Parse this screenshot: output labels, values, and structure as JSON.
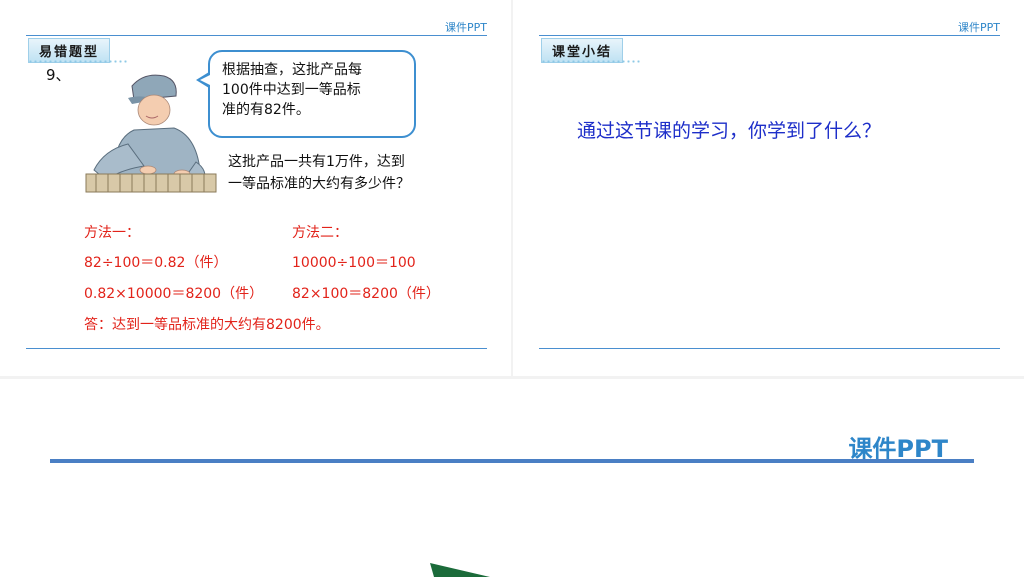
{
  "left_slide": {
    "brand": "课件PPT",
    "tag": "易错题型",
    "question_number": "9、",
    "bubble_lines": [
      "根据抽查，这批产品每",
      "100件中达到一等品标",
      "准的有82件。"
    ],
    "question_lines": [
      "这批产品一共有1万件，达到",
      "一等品标准的大约有多少件？"
    ],
    "method1": {
      "title": "方法一：",
      "line1": "82÷100＝0.82（件）",
      "line2": "0.82×10000＝8200（件）"
    },
    "method2": {
      "title": "方法二：",
      "line1": "10000÷100＝100",
      "line2": "82×100＝8200（件）"
    },
    "answer": "答：达到一等品标准的大约有8200件。"
  },
  "right_slide": {
    "brand": "课件PPT",
    "tag": "课堂小结",
    "summary_question": "通过这节课的学习，你学到了什么？"
  },
  "bottom_slide": {
    "brand": "课件PPT"
  },
  "colors": {
    "accent_blue": "#2e86c9",
    "rule_blue": "#4a8fd0",
    "answer_red": "#e2231a",
    "summary_text": "#1d2ec9",
    "shape_green": "#1b6b3a"
  }
}
